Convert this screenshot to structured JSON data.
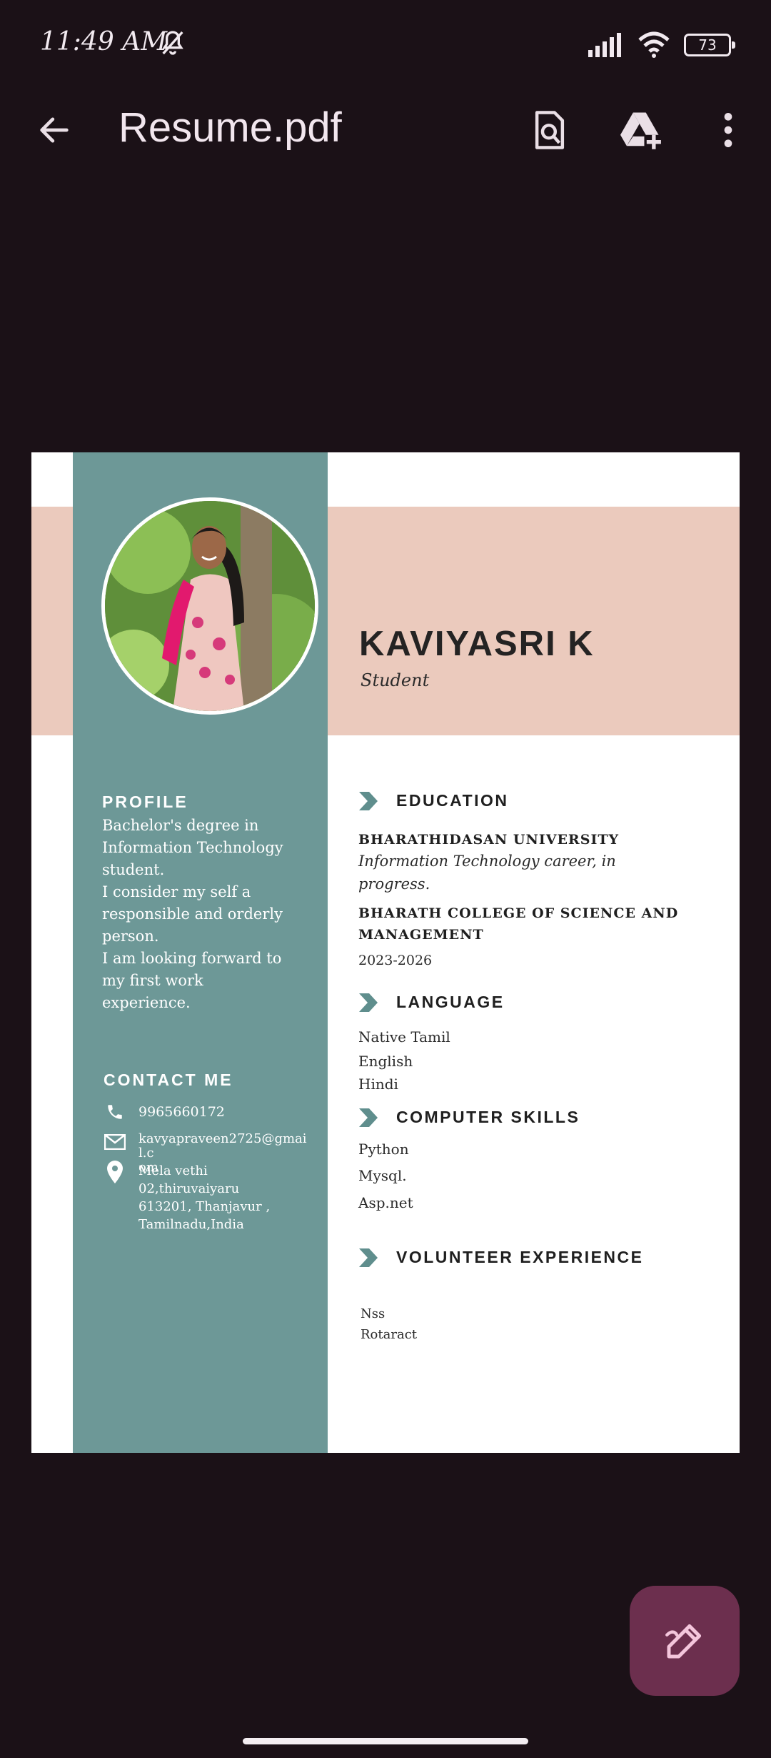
{
  "status_bar": {
    "time": "11:49 AM",
    "battery": "73"
  },
  "toolbar": {
    "title": "Resume.pdf",
    "icons": [
      "back-arrow-icon",
      "find-in-page-icon",
      "drive-add-icon",
      "more-vert-icon"
    ]
  },
  "resume": {
    "name": "KAVIYASRI K",
    "role": "Student",
    "profile": {
      "heading": "PROFILE",
      "lines": [
        "Bachelor's degree in",
        "Information Technology",
        "student.",
        "I consider my self a",
        "responsible and orderly",
        "person.",
        "I am looking forward to",
        "my first work",
        "experience."
      ]
    },
    "contact": {
      "heading": "CONTACT ME",
      "phone": "9965660172",
      "email_line1": "kavyapraveen2725@gmail.c",
      "email_line2": "om",
      "address_lines": [
        "Mela vethi",
        "02,thiruvaiyaru",
        "613201, Thanjavur ,",
        "Tamilnadu,India"
      ]
    },
    "education": {
      "heading": "EDUCATION",
      "university": "BHARATHIDASAN UNIVERSITY",
      "career_line1": "Information Technology career, in",
      "career_line2": "progress.",
      "college_line1": "BHARATH COLLEGE OF SCIENCE AND",
      "college_line2": "MANAGEMENT",
      "years": "2023-2026"
    },
    "language": {
      "heading": "LANGUAGE",
      "items": [
        "Native Tamil",
        "English",
        "Hindi"
      ]
    },
    "computer_skills": {
      "heading": "COMPUTER SKILLS",
      "items": [
        "Python",
        "Mysql.",
        "Asp.net"
      ]
    },
    "volunteer": {
      "heading": "VOLUNTEER EXPERIENCE",
      "items": [
        "Nss",
        "Rotaract"
      ]
    }
  },
  "colors": {
    "background": "#1b1117",
    "teal": "#6d9897",
    "peach": "#ebcabd",
    "fab": "#6c2f4e"
  }
}
